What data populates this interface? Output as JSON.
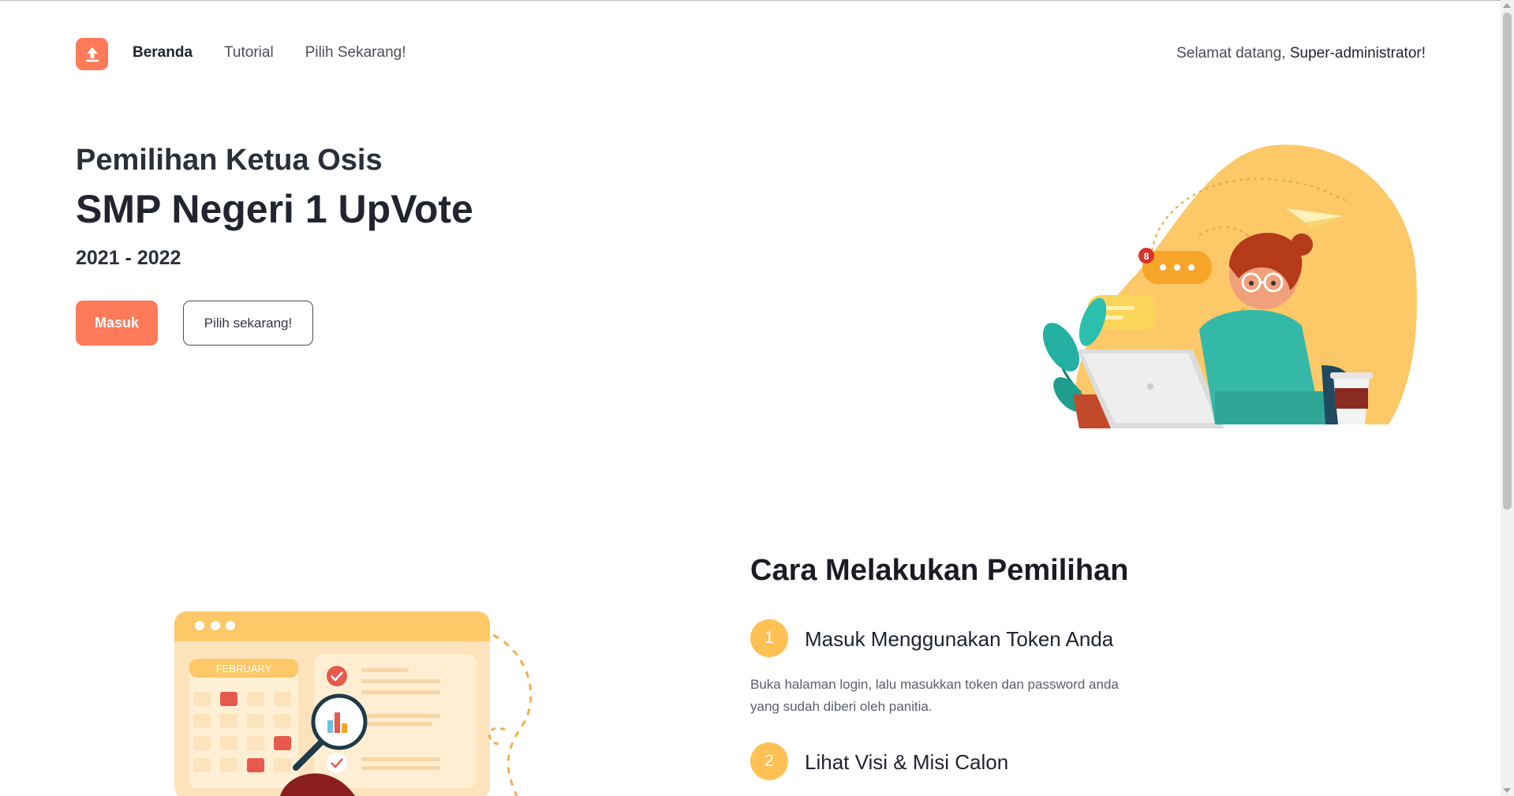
{
  "header": {
    "nav": [
      {
        "label": "Beranda"
      },
      {
        "label": "Tutorial"
      },
      {
        "label": "Pilih Sekarang!"
      }
    ],
    "welcome_prefix": "Selamat datang,",
    "welcome_user": "Super-administrator!"
  },
  "hero": {
    "subtitle": "Pemilihan Ketua Osis",
    "title": "SMP Negeri 1 UpVote",
    "year": "2021 - 2022",
    "primary_button": "Masuk",
    "secondary_button": "Pilih sekarang!",
    "notification_count": "8"
  },
  "steps_section": {
    "title": "Cara Melakukan Pemilihan",
    "calendar_month": "FEBRUARY",
    "steps": [
      {
        "number": "1",
        "title": "Masuk Menggunakan Token Anda",
        "description": "Buka halaman login, lalu masukkan token dan password anda yang sudah diberi oleh panitia."
      },
      {
        "number": "2",
        "title": "Lihat Visi & Misi Calon"
      }
    ]
  },
  "colors": {
    "accent": "#ff7a59",
    "step_badge": "#ffc154",
    "illustration_blob": "#fcc868"
  }
}
